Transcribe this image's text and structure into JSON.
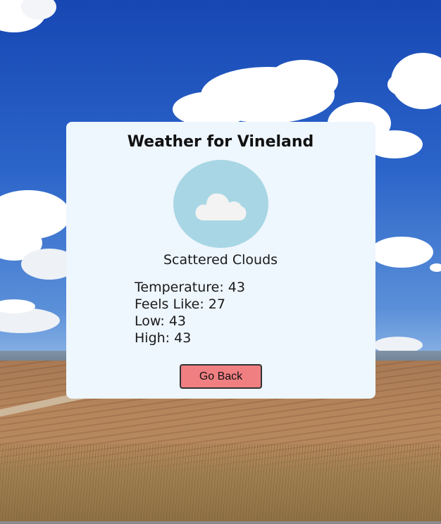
{
  "weather": {
    "title": "Weather for Vineland",
    "icon": "cloud-icon",
    "condition": "Scattered Clouds",
    "stats": [
      {
        "label": "Temperature: 43"
      },
      {
        "label": "Feels Like: 27"
      },
      {
        "label": "Low: 43"
      },
      {
        "label": "High: 43"
      }
    ],
    "back_label": "Go Back"
  },
  "colors": {
    "card_background": "#eef6fe",
    "icon_circle": "#a8d6e4",
    "button_background": "#f07f82"
  }
}
